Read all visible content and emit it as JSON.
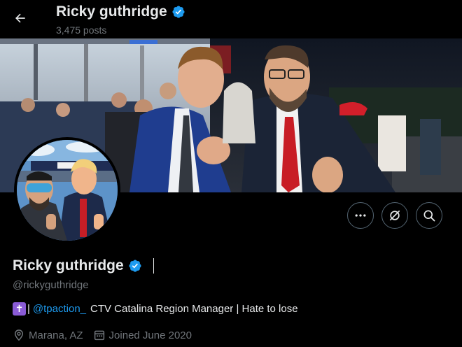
{
  "header": {
    "display_name": "Ricky guthridge",
    "post_count": "3,475 posts"
  },
  "profile": {
    "display_name": "Ricky guthridge",
    "handle": "@rickyguthridge",
    "bio_mention": "@tpaction_",
    "bio_text": "CTV Catalina Region Manager | Hate to lose",
    "location": "Marana, AZ",
    "joined": "Joined June 2020"
  },
  "colors": {
    "verified": "#1d9bf0",
    "link": "#1d9bf0",
    "secondary_text": "#71767b",
    "cross_emoji_bg": "#8a5bd6"
  },
  "icons": {
    "back": "arrow-left-icon",
    "verified": "verified-badge-icon",
    "more": "more-dots-icon",
    "grok": "grok-icon",
    "search": "search-icon",
    "location": "location-pin-icon",
    "calendar": "calendar-icon"
  }
}
